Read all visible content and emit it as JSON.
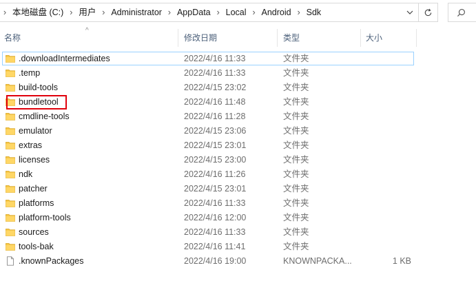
{
  "address": {
    "crumbs": [
      "本地磁盘 (C:)",
      "用户",
      "Administrator",
      "AppData",
      "Local",
      "Android",
      "Sdk"
    ],
    "separator": "›"
  },
  "columns": {
    "name": "名称",
    "date": "修改日期",
    "type": "类型",
    "size": "大小"
  },
  "rows": [
    {
      "name": ".downloadIntermediates",
      "date": "2022/4/16 11:33",
      "type": "文件夹",
      "size": "",
      "icon": "folder-icon"
    },
    {
      "name": ".temp",
      "date": "2022/4/16 11:33",
      "type": "文件夹",
      "size": "",
      "icon": "folder-icon"
    },
    {
      "name": "build-tools",
      "date": "2022/4/15 23:02",
      "type": "文件夹",
      "size": "",
      "icon": "folder-icon"
    },
    {
      "name": "bundletool",
      "date": "2022/4/16 11:48",
      "type": "文件夹",
      "size": "",
      "icon": "folder-icon"
    },
    {
      "name": "cmdline-tools",
      "date": "2022/4/16 11:28",
      "type": "文件夹",
      "size": "",
      "icon": "folder-icon"
    },
    {
      "name": "emulator",
      "date": "2022/4/15 23:06",
      "type": "文件夹",
      "size": "",
      "icon": "folder-icon"
    },
    {
      "name": "extras",
      "date": "2022/4/15 23:01",
      "type": "文件夹",
      "size": "",
      "icon": "folder-icon"
    },
    {
      "name": "licenses",
      "date": "2022/4/15 23:00",
      "type": "文件夹",
      "size": "",
      "icon": "folder-icon"
    },
    {
      "name": "ndk",
      "date": "2022/4/16 11:26",
      "type": "文件夹",
      "size": "",
      "icon": "folder-icon"
    },
    {
      "name": "patcher",
      "date": "2022/4/15 23:01",
      "type": "文件夹",
      "size": "",
      "icon": "folder-icon"
    },
    {
      "name": "platforms",
      "date": "2022/4/16 11:33",
      "type": "文件夹",
      "size": "",
      "icon": "folder-icon"
    },
    {
      "name": "platform-tools",
      "date": "2022/4/16 12:00",
      "type": "文件夹",
      "size": "",
      "icon": "folder-icon"
    },
    {
      "name": "sources",
      "date": "2022/4/16 11:33",
      "type": "文件夹",
      "size": "",
      "icon": "folder-icon"
    },
    {
      "name": "tools-bak",
      "date": "2022/4/16 11:41",
      "type": "文件夹",
      "size": "",
      "icon": "folder-icon"
    },
    {
      "name": ".knownPackages",
      "date": "2022/4/16 19:00",
      "type": "KNOWNPACKA...",
      "size": "1 KB",
      "icon": "file-icon"
    }
  ],
  "selected_row": 0,
  "highlighted_row": 3,
  "colors": {
    "highlight_border": "#e0000b",
    "selection_border": "#99d1ff",
    "folder": "#f5c542",
    "header_text": "#4c607a"
  }
}
